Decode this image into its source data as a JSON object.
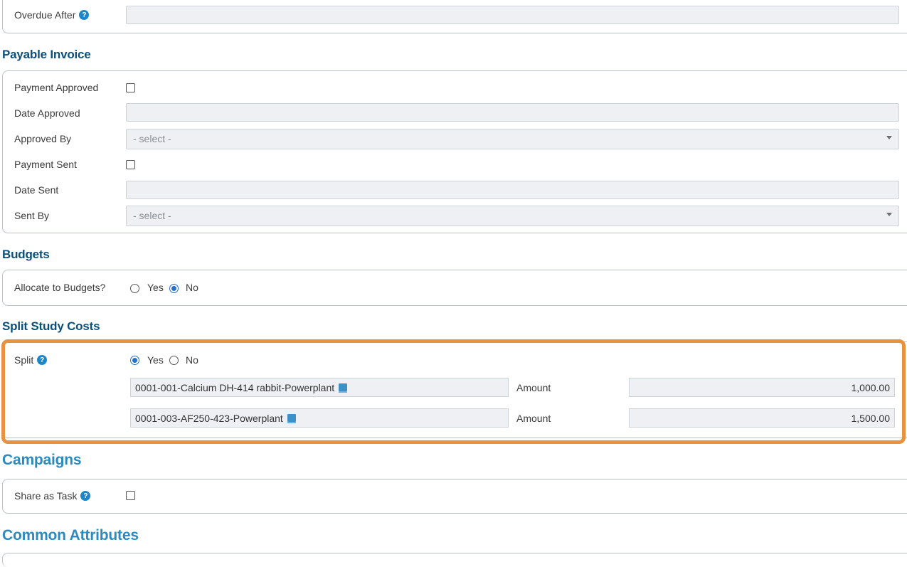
{
  "overdue": {
    "label": "Overdue After",
    "value": ""
  },
  "payable": {
    "title": "Payable Invoice",
    "payment_approved": "Payment Approved",
    "date_approved": "Date Approved",
    "approved_by": "Approved By",
    "approved_by_value": "- select -",
    "payment_sent": "Payment Sent",
    "date_sent": "Date Sent",
    "sent_by": "Sent By",
    "sent_by_value": "- select -"
  },
  "budgets": {
    "title": "Budgets",
    "allocate_label": "Allocate to Budgets?",
    "yes": "Yes",
    "no": "No",
    "selected": "No"
  },
  "split_costs": {
    "title": "Split Study Costs",
    "split_label": "Split",
    "yes": "Yes",
    "no": "No",
    "selected": "Yes",
    "amount_label": "Amount",
    "rows": [
      {
        "study": "0001-001-Calcium DH-414 rabbit-Powerplant",
        "amount": "1,000.00"
      },
      {
        "study": "0001-003-AF250-423-Powerplant",
        "amount": "1,500.00"
      }
    ]
  },
  "campaigns": {
    "title": "Campaigns",
    "share_label": "Share as Task"
  },
  "common": {
    "title": "Common Attributes"
  },
  "help_glyph": "?",
  "colors": {
    "heading": "#0b4f7a",
    "heading_large": "#2a8bc0",
    "highlight": "#e8913f",
    "radio": "#1f72c7"
  }
}
